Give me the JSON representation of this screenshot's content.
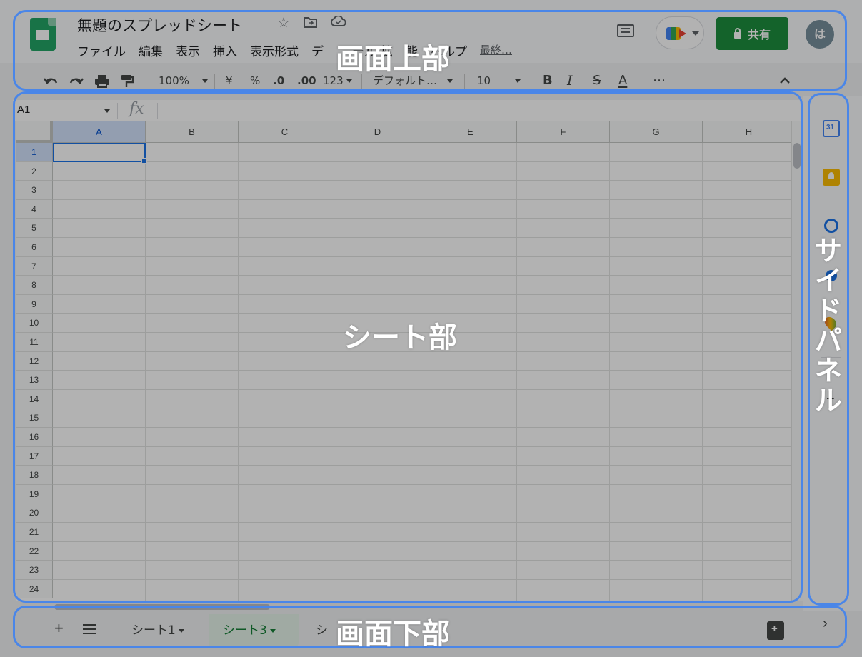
{
  "header": {
    "doc_title": "無題のスプレッドシート",
    "icons": [
      "star-icon",
      "move-folder-icon",
      "cloud-status-icon"
    ],
    "menu": [
      "ファイル",
      "編集",
      "表示",
      "挿入",
      "表示形式",
      "デ",
      "ール",
      "拡",
      "能",
      "ヘルプ"
    ],
    "last_edit": "最終…",
    "share_label": "共有",
    "avatar_initial": "は"
  },
  "toolbar": {
    "zoom": "100%",
    "currency": "¥",
    "percent": "%",
    "decimal_decrease": ".0",
    "decimal_increase": ".00",
    "more_formats": "123",
    "font": "デフォルト…",
    "font_size": "10",
    "bold": "B",
    "italic": "I",
    "strike": "S",
    "text_color": "A",
    "more": "⋯"
  },
  "formula_bar": {
    "name_box": "A1",
    "fx": "fx",
    "value": ""
  },
  "grid": {
    "columns": [
      "A",
      "B",
      "C",
      "D",
      "E",
      "F",
      "G",
      "H"
    ],
    "rows": [
      "1",
      "2",
      "3",
      "4",
      "5",
      "6",
      "7",
      "8",
      "9",
      "10",
      "11",
      "12",
      "13",
      "14",
      "15",
      "16",
      "17",
      "18",
      "19",
      "20",
      "21",
      "22",
      "23",
      "24"
    ],
    "active_cell": "A1"
  },
  "sheet_tabs": {
    "tabs": [
      {
        "label": "シート1",
        "active": false
      },
      {
        "label": "シート3",
        "active": true
      },
      {
        "label": "シ",
        "active": false
      }
    ]
  },
  "side_panel": {
    "icons": [
      "calendar-icon",
      "keep-icon",
      "tasks-icon",
      "contacts-icon",
      "maps-icon",
      "add-icon"
    ]
  },
  "annotations": {
    "top": "画面上部",
    "sheet": "シート部",
    "side_chars": [
      "サ",
      "イ",
      "ド",
      "パ",
      "ネ",
      "ル"
    ],
    "bottom": "画面下部"
  },
  "colors": {
    "overlay_border": "#4a86e8",
    "share_green": "#1e8e3e",
    "selection_blue": "#1a73e8"
  }
}
